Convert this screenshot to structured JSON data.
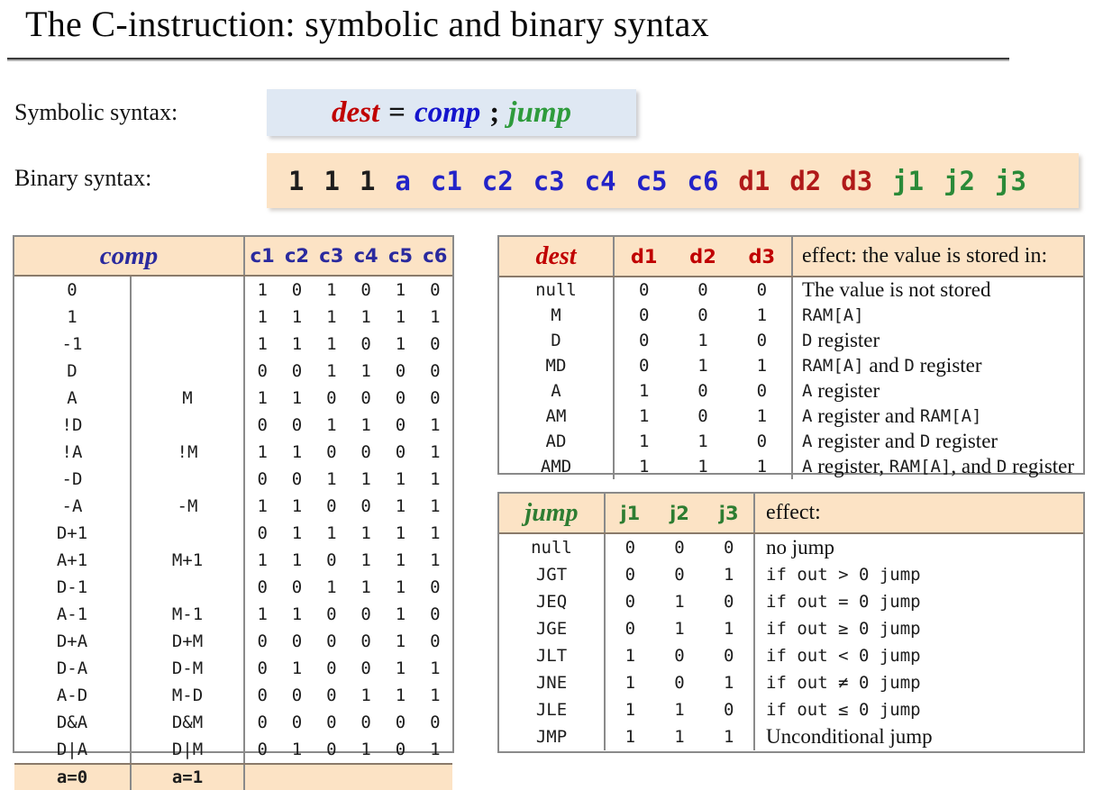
{
  "slide": {
    "title": "The C-instruction: symbolic and binary syntax"
  },
  "syntax": {
    "symbolic_label": "Symbolic syntax:",
    "binary_label": "Binary syntax:",
    "symbolic": {
      "dest": "dest",
      "equals": "=",
      "comp": "comp",
      "semicolon": ";",
      "jump": "jump",
      "dest_color": "#c00000",
      "comp_color": "#1414cd",
      "jump_color": "#2e9b3c",
      "background": "#dfe8f3"
    },
    "binary": {
      "background": "#fce3c5",
      "bits": [
        {
          "text": "1",
          "group": "one"
        },
        {
          "text": "1",
          "group": "one"
        },
        {
          "text": "1",
          "group": "one"
        },
        {
          "text": "a",
          "group": "a"
        },
        {
          "text": "c1",
          "group": "c"
        },
        {
          "text": "c2",
          "group": "c"
        },
        {
          "text": "c3",
          "group": "c"
        },
        {
          "text": "c4",
          "group": "c"
        },
        {
          "text": "c5",
          "group": "c"
        },
        {
          "text": "c6",
          "group": "c"
        },
        {
          "text": "d1",
          "group": "d"
        },
        {
          "text": "d2",
          "group": "d"
        },
        {
          "text": "d3",
          "group": "d"
        },
        {
          "text": "j1",
          "group": "j"
        },
        {
          "text": "j2",
          "group": "j"
        },
        {
          "text": "j3",
          "group": "j"
        }
      ]
    }
  },
  "comp_table": {
    "header_label": "comp",
    "bit_headers": [
      "c1",
      "c2",
      "c3",
      "c4",
      "c5",
      "c6"
    ],
    "footer": {
      "a0": "a=0",
      "a1": "a=1"
    },
    "rows": [
      {
        "a": "0",
        "m": "",
        "bits": [
          "1",
          "0",
          "1",
          "0",
          "1",
          "0"
        ]
      },
      {
        "a": "1",
        "m": "",
        "bits": [
          "1",
          "1",
          "1",
          "1",
          "1",
          "1"
        ]
      },
      {
        "a": "-1",
        "m": "",
        "bits": [
          "1",
          "1",
          "1",
          "0",
          "1",
          "0"
        ]
      },
      {
        "a": "D",
        "m": "",
        "bits": [
          "0",
          "0",
          "1",
          "1",
          "0",
          "0"
        ]
      },
      {
        "a": "A",
        "m": "M",
        "bits": [
          "1",
          "1",
          "0",
          "0",
          "0",
          "0"
        ]
      },
      {
        "a": "!D",
        "m": "",
        "bits": [
          "0",
          "0",
          "1",
          "1",
          "0",
          "1"
        ]
      },
      {
        "a": "!A",
        "m": "!M",
        "bits": [
          "1",
          "1",
          "0",
          "0",
          "0",
          "1"
        ]
      },
      {
        "a": "-D",
        "m": "",
        "bits": [
          "0",
          "0",
          "1",
          "1",
          "1",
          "1"
        ]
      },
      {
        "a": "-A",
        "m": "-M",
        "bits": [
          "1",
          "1",
          "0",
          "0",
          "1",
          "1"
        ]
      },
      {
        "a": "D+1",
        "m": "",
        "bits": [
          "0",
          "1",
          "1",
          "1",
          "1",
          "1"
        ]
      },
      {
        "a": "A+1",
        "m": "M+1",
        "bits": [
          "1",
          "1",
          "0",
          "1",
          "1",
          "1"
        ]
      },
      {
        "a": "D-1",
        "m": "",
        "bits": [
          "0",
          "0",
          "1",
          "1",
          "1",
          "0"
        ]
      },
      {
        "a": "A-1",
        "m": "M-1",
        "bits": [
          "1",
          "1",
          "0",
          "0",
          "1",
          "0"
        ]
      },
      {
        "a": "D+A",
        "m": "D+M",
        "bits": [
          "0",
          "0",
          "0",
          "0",
          "1",
          "0"
        ]
      },
      {
        "a": "D-A",
        "m": "D-M",
        "bits": [
          "0",
          "1",
          "0",
          "0",
          "1",
          "1"
        ]
      },
      {
        "a": "A-D",
        "m": "M-D",
        "bits": [
          "0",
          "0",
          "0",
          "1",
          "1",
          "1"
        ]
      },
      {
        "a": "D&A",
        "m": "D&M",
        "bits": [
          "0",
          "0",
          "0",
          "0",
          "0",
          "0"
        ]
      },
      {
        "a": "D|A",
        "m": "D|M",
        "bits": [
          "0",
          "1",
          "0",
          "1",
          "0",
          "1"
        ]
      }
    ]
  },
  "dest_table": {
    "header_label": "dest",
    "bit_headers": [
      "d1",
      "d2",
      "d3"
    ],
    "effect_header": "effect: the value is stored in:",
    "rows": [
      {
        "dest": "null",
        "bits": [
          "0",
          "0",
          "0"
        ],
        "effect_parts": [
          {
            "t": "The value is not stored",
            "f": "serif"
          }
        ]
      },
      {
        "dest": "M",
        "bits": [
          "0",
          "0",
          "1"
        ],
        "effect_parts": [
          {
            "t": "RAM[A]",
            "f": "mono"
          }
        ]
      },
      {
        "dest": "D",
        "bits": [
          "0",
          "1",
          "0"
        ],
        "effect_parts": [
          {
            "t": "D",
            "f": "mono"
          },
          {
            "t": " register",
            "f": "serif"
          }
        ]
      },
      {
        "dest": "MD",
        "bits": [
          "0",
          "1",
          "1"
        ],
        "effect_parts": [
          {
            "t": "RAM[A]",
            "f": "mono"
          },
          {
            "t": " and ",
            "f": "serif"
          },
          {
            "t": "D",
            "f": "mono"
          },
          {
            "t": " register",
            "f": "serif"
          }
        ]
      },
      {
        "dest": "A",
        "bits": [
          "1",
          "0",
          "0"
        ],
        "effect_parts": [
          {
            "t": "A",
            "f": "mono"
          },
          {
            "t": " register",
            "f": "serif"
          }
        ]
      },
      {
        "dest": "AM",
        "bits": [
          "1",
          "0",
          "1"
        ],
        "effect_parts": [
          {
            "t": "A",
            "f": "mono"
          },
          {
            "t": " register and ",
            "f": "serif"
          },
          {
            "t": "RAM[A]",
            "f": "mono"
          }
        ]
      },
      {
        "dest": "AD",
        "bits": [
          "1",
          "1",
          "0"
        ],
        "effect_parts": [
          {
            "t": "A",
            "f": "mono"
          },
          {
            "t": " register and ",
            "f": "serif"
          },
          {
            "t": "D",
            "f": "mono"
          },
          {
            "t": " register",
            "f": "serif"
          }
        ]
      },
      {
        "dest": "AMD",
        "bits": [
          "1",
          "1",
          "1"
        ],
        "effect_parts": [
          {
            "t": "A",
            "f": "mono"
          },
          {
            "t": " register, ",
            "f": "serif"
          },
          {
            "t": "RAM[A]",
            "f": "mono"
          },
          {
            "t": ", and ",
            "f": "serif"
          },
          {
            "t": "D",
            "f": "mono"
          },
          {
            "t": " register",
            "f": "serif"
          }
        ]
      }
    ]
  },
  "jump_table": {
    "header_label": "jump",
    "bit_headers": [
      "j1",
      "j2",
      "j3"
    ],
    "effect_header": "effect:",
    "rows": [
      {
        "jump": "null",
        "bits": [
          "0",
          "0",
          "0"
        ],
        "effect_parts": [
          {
            "t": "no jump",
            "f": "serif"
          }
        ]
      },
      {
        "jump": "JGT",
        "bits": [
          "0",
          "0",
          "1"
        ],
        "effect_parts": [
          {
            "t": "if out > 0 jump",
            "f": "mono"
          }
        ]
      },
      {
        "jump": "JEQ",
        "bits": [
          "0",
          "1",
          "0"
        ],
        "effect_parts": [
          {
            "t": "if out = 0 jump",
            "f": "mono"
          }
        ]
      },
      {
        "jump": "JGE",
        "bits": [
          "0",
          "1",
          "1"
        ],
        "effect_parts": [
          {
            "t": "if out ≥ 0 jump",
            "f": "mono"
          }
        ]
      },
      {
        "jump": "JLT",
        "bits": [
          "1",
          "0",
          "0"
        ],
        "effect_parts": [
          {
            "t": "if out < 0 jump",
            "f": "mono"
          }
        ]
      },
      {
        "jump": "JNE",
        "bits": [
          "1",
          "0",
          "1"
        ],
        "effect_parts": [
          {
            "t": "if out ≠ 0 jump",
            "f": "mono"
          }
        ]
      },
      {
        "jump": "JLE",
        "bits": [
          "1",
          "1",
          "0"
        ],
        "effect_parts": [
          {
            "t": "if out ≤ 0 jump",
            "f": "mono"
          }
        ]
      },
      {
        "jump": "JMP",
        "bits": [
          "1",
          "1",
          "1"
        ],
        "effect_parts": [
          {
            "t": "Unconditional jump",
            "f": "serif"
          }
        ]
      }
    ]
  },
  "colors": {
    "header_fill": "#fce3c5",
    "symbolic_fill": "#dfe8f3",
    "border": "#8a8a8a"
  }
}
